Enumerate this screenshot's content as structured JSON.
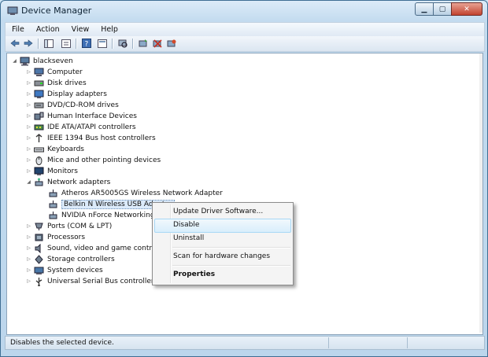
{
  "window": {
    "title": "Device Manager"
  },
  "menubar": {
    "items": [
      "File",
      "Action",
      "View",
      "Help"
    ]
  },
  "tree": {
    "root": "blackseven",
    "categories": {
      "computer": "Computer",
      "disk": "Disk drives",
      "display": "Display adapters",
      "dvd": "DVD/CD-ROM drives",
      "hid": "Human Interface Devices",
      "ide": "IDE ATA/ATAPI controllers",
      "ieee": "IEEE 1394 Bus host controllers",
      "keyboards": "Keyboards",
      "mice": "Mice and other pointing devices",
      "monitors": "Monitors",
      "network": "Network adapters",
      "ports": "Ports (COM & LPT)",
      "processors": "Processors",
      "sound": "Sound, video and game controllers",
      "storage": "Storage controllers",
      "system": "System devices",
      "usb": "Universal Serial Bus controllers"
    },
    "network_children": {
      "atheros": "Atheros AR5005GS Wireless Network Adapter",
      "belkin": "Belkin N Wireless USB Adapter",
      "nvidia": "NVIDIA nForce Networking C"
    }
  },
  "context_menu": {
    "update": "Update Driver Software...",
    "disable": "Disable",
    "uninstall": "Uninstall",
    "scan": "Scan for hardware changes",
    "properties": "Properties"
  },
  "statusbar": {
    "text": "Disables the selected device."
  }
}
